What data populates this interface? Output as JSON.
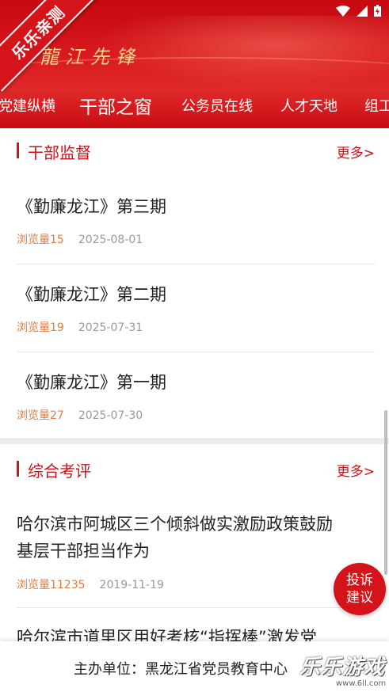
{
  "header": {
    "ribbon_text": "乐乐亲测",
    "logo_text": "龍江先锋",
    "tabs": [
      "党建纵横",
      "干部之窗",
      "公务员在线",
      "人才天地",
      "组工"
    ],
    "active_tab": "干部之窗"
  },
  "sections": [
    {
      "title": "干部监督",
      "more": "更多>",
      "items": [
        {
          "title": "《勤廉龙江》第三期",
          "views": "浏览量15",
          "date": "2025-08-01"
        },
        {
          "title": "《勤廉龙江》第二期",
          "views": "浏览量19",
          "date": "2025-07-31"
        },
        {
          "title": "《勤廉龙江》第一期",
          "views": "浏览量27",
          "date": "2025-07-30"
        }
      ]
    },
    {
      "title": "综合考评",
      "more": "更多>",
      "items": [
        {
          "title_line1": "哈尔滨市阿城区三个倾斜做实激励政策鼓励",
          "title_line2": "基层干部担当作为",
          "views": "浏览量11235",
          "date": "2019-11-19"
        },
        {
          "title_partial": "哈尔滨市道里区用好考核“指挥棒”激发党"
        }
      ]
    }
  ],
  "fab": {
    "line1": "投诉",
    "line2": "建议"
  },
  "footer": {
    "text": "主办单位：黑龙江省党员教育中心"
  },
  "watermark": {
    "text": "乐乐游戏",
    "url": "www.6ll.com"
  },
  "colors": {
    "brand_red": "#d4141a",
    "views_orange": "#e07b3c",
    "date_gray": "#999999"
  }
}
